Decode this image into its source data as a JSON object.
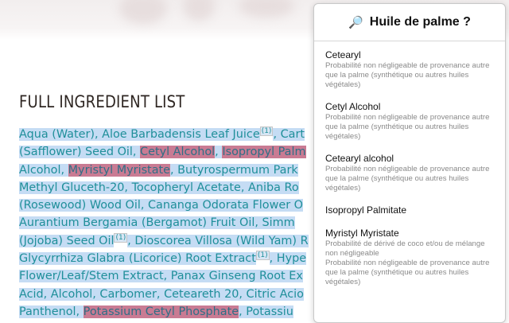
{
  "page": {
    "heading": "FULL INGREDIENT LIST",
    "ingredient_lines": [
      [
        {
          "t": "Aqua (Water), Aloe Barbadensis Leaf Juice"
        },
        {
          "sup": "(1)"
        },
        {
          "t": ", Cart"
        }
      ],
      [
        {
          "t": "(Safflower) Seed Oil, "
        },
        {
          "t": "Cetyl Alcohol",
          "hl": true
        },
        {
          "t": ", "
        },
        {
          "t": "Isopropyl Palm",
          "hl": true
        }
      ],
      [
        {
          "t": "Alcohol, "
        },
        {
          "t": "Myristyl Myristate",
          "hl": true
        },
        {
          "t": ", Butyrospermum Park"
        }
      ],
      [
        {
          "t": "Methyl Gluceth-20, Tocopheryl Acetate, Aniba Ro"
        }
      ],
      [
        {
          "t": "(Rosewood) Wood Oil, Cananga Odorata Flower O"
        }
      ],
      [
        {
          "t": "Aurantium Bergamia (Bergamot) Fruit Oil, Simm"
        }
      ],
      [
        {
          "t": "(Jojoba) Seed Oil"
        },
        {
          "sup": "(1)"
        },
        {
          "t": ", Dioscorea Villosa (Wild Yam) R"
        }
      ],
      [
        {
          "t": "Glycyrrhiza Glabra (Licorice) Root Extract"
        },
        {
          "sup": "(1)"
        },
        {
          "t": ", Hype"
        }
      ],
      [
        {
          "t": "Flower/Leaf/Stem Extract, Panax Ginseng Root Ex"
        }
      ],
      [
        {
          "t": "Acid, Alcohol, Carbomer, Ceteareth 20, Citric Acio"
        }
      ],
      [
        {
          "t": "Panthenol, "
        },
        {
          "t": "Potassium Cetyl Phosphate",
          "hl": true
        },
        {
          "t": ", Potassiu"
        }
      ]
    ]
  },
  "popup": {
    "icon": "magnifier-icon",
    "title": "Huile de palme ?",
    "entries": [
      {
        "name": "Cetearyl",
        "note": "Probabilité non négligeable de provenance autre que la palme (synthétique ou autres huiles végétales)"
      },
      {
        "name": "Cetyl Alcohol",
        "note": "Probabilité non négligeable de provenance autre que la palme (synthétique ou autres huiles végétales)"
      },
      {
        "name": "Cetearyl alcohol",
        "note": "Probabilité non négligeable de provenance autre que la palme (synthétique ou autres huiles végétales)"
      },
      {
        "name": "Isopropyl Palmitate",
        "note": ""
      },
      {
        "name": "Myristyl Myristate",
        "note": "Probabilité de dérivé de coco et/ou de mélange non négligeable\nProbabilité non négligeable de provenance autre que la palme (synthétique ou autres huiles végétales)"
      }
    ]
  },
  "colors": {
    "text_teal": "#1f8f9a",
    "selection_blue": "#c5dcf4",
    "highlight_pink": "#c97b93"
  }
}
